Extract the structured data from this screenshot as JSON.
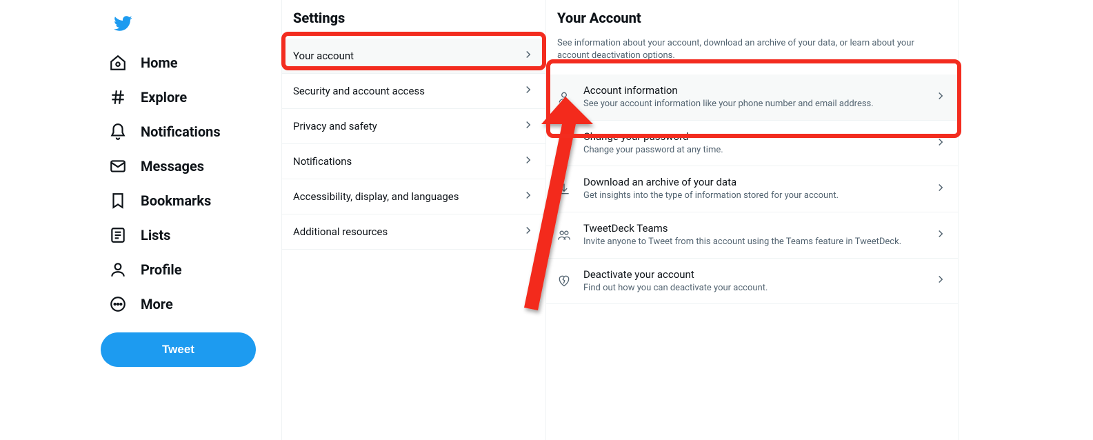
{
  "sidebar": {
    "items": [
      {
        "label": "Home"
      },
      {
        "label": "Explore"
      },
      {
        "label": "Notifications"
      },
      {
        "label": "Messages"
      },
      {
        "label": "Bookmarks"
      },
      {
        "label": "Lists"
      },
      {
        "label": "Profile"
      },
      {
        "label": "More"
      }
    ],
    "tweet_label": "Tweet"
  },
  "settings": {
    "title": "Settings",
    "items": [
      {
        "label": "Your account"
      },
      {
        "label": "Security and account access"
      },
      {
        "label": "Privacy and safety"
      },
      {
        "label": "Notifications"
      },
      {
        "label": "Accessibility, display, and languages"
      },
      {
        "label": "Additional resources"
      }
    ]
  },
  "detail": {
    "title": "Your Account",
    "description": "See information about your account, download an archive of your data, or learn about your account deactivation options.",
    "items": [
      {
        "title": "Account information",
        "sub": "See your account information like your phone number and email address."
      },
      {
        "title": "Change your password",
        "sub": "Change your password at any time."
      },
      {
        "title": "Download an archive of your data",
        "sub": "Get insights into the type of information stored for your account."
      },
      {
        "title": "TweetDeck Teams",
        "sub": "Invite anyone to Tweet from this account using the Teams feature in TweetDeck."
      },
      {
        "title": "Deactivate your account",
        "sub": "Find out how you can deactivate your account."
      }
    ]
  },
  "colors": {
    "accent": "#1d9bf0",
    "annotation": "#f32c1f"
  }
}
